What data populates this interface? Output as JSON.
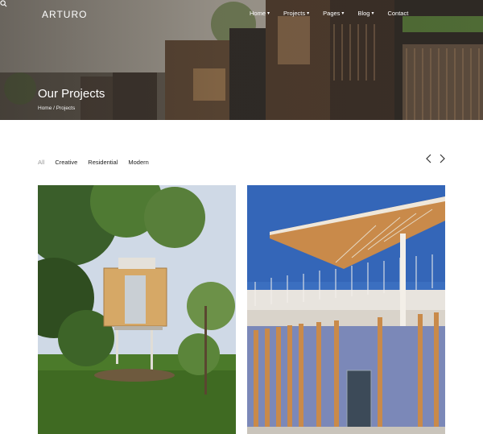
{
  "header": {
    "logo": "ARTURO",
    "nav": [
      {
        "label": "Home",
        "has_dropdown": true
      },
      {
        "label": "Projects",
        "has_dropdown": true
      },
      {
        "label": "Pages",
        "has_dropdown": true
      },
      {
        "label": "Blog",
        "has_dropdown": true
      },
      {
        "label": "Contact",
        "has_dropdown": false
      }
    ],
    "search_icon": "search-icon"
  },
  "hero": {
    "title": "Our Projects",
    "breadcrumb": "Home / Projects"
  },
  "filters": {
    "items": [
      "All",
      "Creative",
      "Residential",
      "Modern"
    ],
    "active": "All"
  },
  "carousel": {
    "prev_icon": "chevron-left-icon",
    "next_icon": "chevron-right-icon"
  },
  "projects": [
    {
      "image": "treehouse-photo"
    },
    {
      "image": "curved-pavilion-photo"
    }
  ],
  "colors": {
    "text_dark": "#222222",
    "text_muted": "#9a9a9a",
    "sky_blue": "#3b6fc0",
    "wood": "#c98a4a",
    "grass": "#4b7a2a"
  }
}
